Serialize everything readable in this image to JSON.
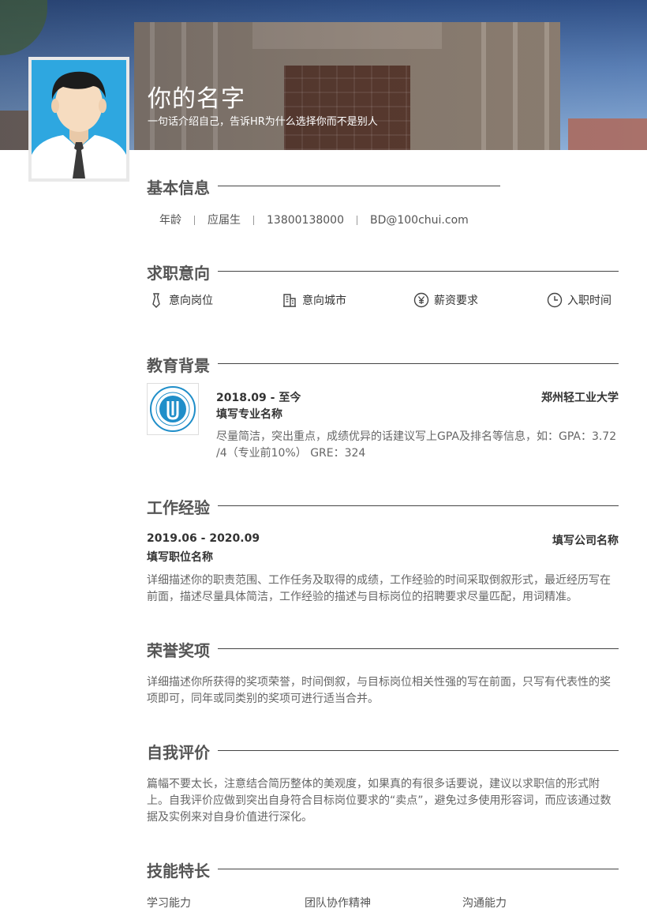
{
  "header": {
    "name": "你的名字",
    "tagline": "一句话介绍自己，告诉HR为什么选择你而不是别人"
  },
  "basic_info": {
    "title": "基本信息",
    "items": [
      "年龄",
      "应届生",
      "13800138000",
      "BD@100chui.com"
    ]
  },
  "job_intent": {
    "title": "求职意向",
    "items": [
      {
        "label": "意向岗位",
        "icon": "tie-icon"
      },
      {
        "label": "意向城市",
        "icon": "building-icon"
      },
      {
        "label": "薪资要求",
        "icon": "yen-icon"
      },
      {
        "label": "入职时间",
        "icon": "clock-icon"
      }
    ]
  },
  "education": {
    "title": "教育背景",
    "date": "2018.09 - 至今",
    "school": "郑州轻工业大学",
    "major": "填写专业名称",
    "desc": "尽量简洁，突出重点，成绩优异的话建议写上GPA及排名等信息，如：GPA：3.72 /4（专业前10%） GRE：324"
  },
  "work": {
    "title": "工作经验",
    "date": "2019.06 - 2020.09",
    "company": "填写公司名称",
    "position": "填写职位名称",
    "desc": "详细描述你的职责范围、工作任务及取得的成绩，工作经验的时间采取倒叙形式，最近经历写在前面，描述尽量具体简洁，工作经验的描述与目标岗位的招聘要求尽量匹配，用词精准。"
  },
  "honors": {
    "title": "荣誉奖项",
    "desc": "详细描述你所获得的奖项荣誉，时间倒叙，与目标岗位相关性强的写在前面，只写有代表性的奖项即可，同年或同类别的奖项可进行适当合并。"
  },
  "self_eval": {
    "title": "自我评价",
    "desc": "篇幅不要太长，注意结合简历整体的美观度，如果真的有很多话要说，建议以求职信的形式附上。自我评价应做到突出自身符合目标岗位要求的“卖点”，避免过多使用形容词，而应该通过数据及实例来对自身价值进行深化。"
  },
  "skills": {
    "title": "技能特长",
    "items": [
      "学习能力",
      "团队协作精神",
      "沟通能力"
    ]
  },
  "colors": {
    "avatar_bg": "#2ea7e0",
    "heading": "#555555",
    "rule": "#444444"
  }
}
